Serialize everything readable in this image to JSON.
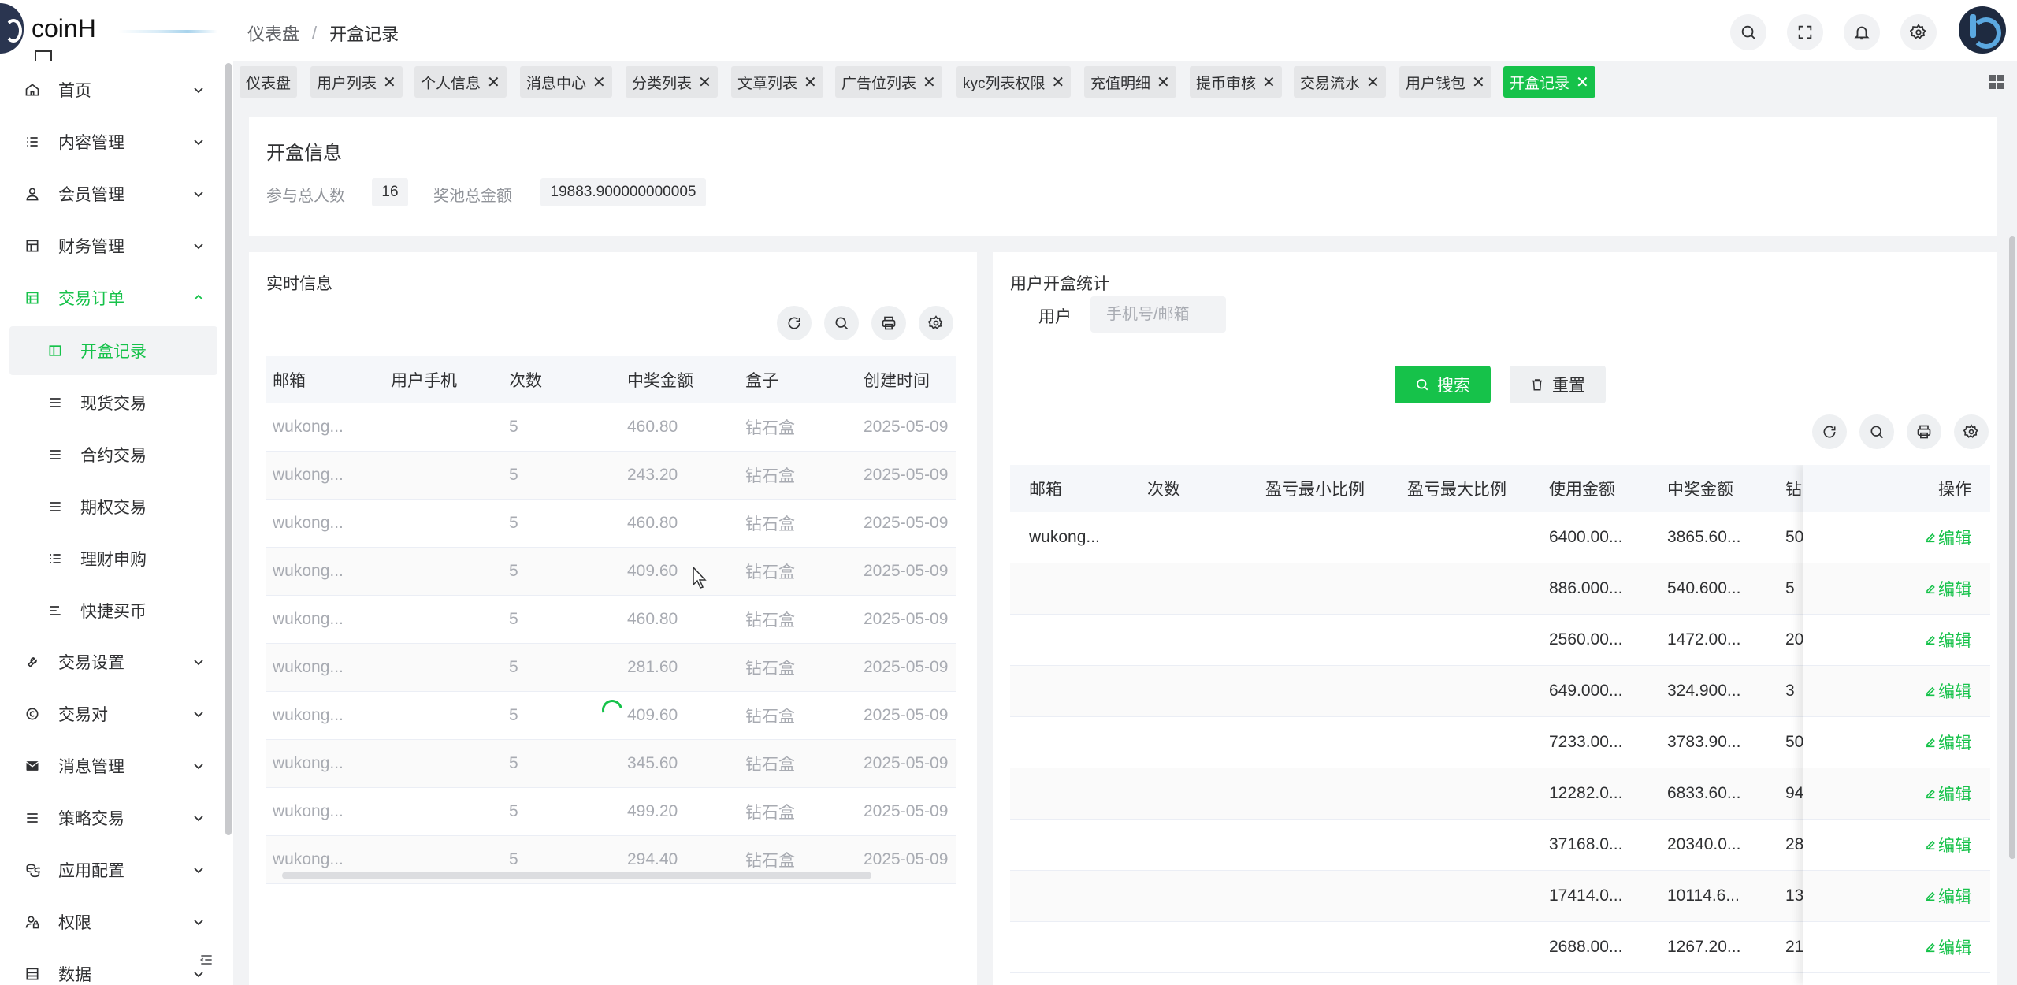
{
  "app": {
    "logo_text": "coinH"
  },
  "breadcrumb": {
    "parent": "仪表盘",
    "separator": "/",
    "current": "开盒记录"
  },
  "header_icons": [
    "search-icon",
    "fullscreen-icon",
    "bell-icon",
    "gear-icon"
  ],
  "sidebar": {
    "items": [
      {
        "label": "首页",
        "icon": "home-icon"
      },
      {
        "label": "内容管理",
        "icon": "list-icon"
      },
      {
        "label": "会员管理",
        "icon": "user-icon"
      },
      {
        "label": "财务管理",
        "icon": "layout-icon"
      },
      {
        "label": "交易订单",
        "icon": "table-icon",
        "expanded": true
      },
      {
        "label": "交易设置",
        "icon": "tool-icon"
      },
      {
        "label": "交易对",
        "icon": "copyright-icon"
      },
      {
        "label": "消息管理",
        "icon": "mail-icon"
      },
      {
        "label": "策略交易",
        "icon": "menu-icon"
      },
      {
        "label": "应用配置",
        "icon": "coins-icon"
      },
      {
        "label": "权限",
        "icon": "user-lock-icon"
      },
      {
        "label": "数据",
        "icon": "data-icon"
      }
    ],
    "sub_items": [
      {
        "label": "开盒记录",
        "active": true
      },
      {
        "label": "现货交易"
      },
      {
        "label": "合约交易"
      },
      {
        "label": "期权交易"
      },
      {
        "label": "理财申购"
      },
      {
        "label": "快捷买币"
      }
    ]
  },
  "tabs": [
    {
      "label": "仪表盘",
      "closable": false
    },
    {
      "label": "用户列表"
    },
    {
      "label": "个人信息"
    },
    {
      "label": "消息中心"
    },
    {
      "label": "分类列表"
    },
    {
      "label": "文章列表"
    },
    {
      "label": "广告位列表"
    },
    {
      "label": "kyc列表权限"
    },
    {
      "label": "充值明细"
    },
    {
      "label": "提币审核"
    },
    {
      "label": "交易流水"
    },
    {
      "label": "用户钱包"
    },
    {
      "label": "开盒记录",
      "active": true
    }
  ],
  "tab_close_glyph": "✕",
  "summary": {
    "title": "开盒信息",
    "participants_label": "参与总人数",
    "participants_value": "16",
    "pool_label": "奖池总金额",
    "pool_value": "19883.900000000005"
  },
  "realtime": {
    "title": "实时信息",
    "columns": [
      "邮箱",
      "用户手机",
      "次数",
      "中奖金额",
      "盒子",
      "创建时间"
    ],
    "rows": [
      [
        "wukong...",
        "",
        "5",
        "460.80",
        "钻石盒",
        "2025-05-09"
      ],
      [
        "wukong...",
        "",
        "5",
        "243.20",
        "钻石盒",
        "2025-05-09"
      ],
      [
        "wukong...",
        "",
        "5",
        "460.80",
        "钻石盒",
        "2025-05-09"
      ],
      [
        "wukong...",
        "",
        "5",
        "409.60",
        "钻石盒",
        "2025-05-09"
      ],
      [
        "wukong...",
        "",
        "5",
        "460.80",
        "钻石盒",
        "2025-05-09"
      ],
      [
        "wukong...",
        "",
        "5",
        "281.60",
        "钻石盒",
        "2025-05-09"
      ],
      [
        "wukong...",
        "",
        "5",
        "409.60",
        "钻石盒",
        "2025-05-09"
      ],
      [
        "wukong...",
        "",
        "5",
        "345.60",
        "钻石盒",
        "2025-05-09"
      ],
      [
        "wukong...",
        "",
        "5",
        "499.20",
        "钻石盒",
        "2025-05-09"
      ],
      [
        "wukong...",
        "",
        "5",
        "294.40",
        "钻石盒",
        "2025-05-09"
      ]
    ]
  },
  "user_stats": {
    "title": "用户开盒统计",
    "user_label": "用户",
    "search_placeholder": "手机号/邮箱",
    "search_button": "搜索",
    "reset_button": "重置",
    "columns": [
      "邮箱",
      "次数",
      "盈亏最小比例",
      "盈亏最大比例",
      "使用金额",
      "中奖金额",
      "钻"
    ],
    "action_header": "操作",
    "action_label": "编辑",
    "rows": [
      [
        "wukong...",
        "",
        "",
        "",
        "6400.00...",
        "3865.60...",
        "50"
      ],
      [
        "",
        "",
        "",
        "",
        "886.000...",
        "540.600...",
        "5"
      ],
      [
        "",
        "",
        "",
        "",
        "2560.00...",
        "1472.00...",
        "20"
      ],
      [
        "",
        "",
        "",
        "",
        "649.000...",
        "324.900...",
        "3"
      ],
      [
        "",
        "",
        "",
        "",
        "7233.00...",
        "3783.90...",
        "50"
      ],
      [
        "",
        "",
        "",
        "",
        "12282.0...",
        "6833.60...",
        "94"
      ],
      [
        "",
        "",
        "",
        "",
        "37168.0...",
        "20340.0...",
        "28"
      ],
      [
        "",
        "",
        "",
        "",
        "17414.0...",
        "10114.6...",
        "13"
      ],
      [
        "",
        "",
        "",
        "",
        "2688.00...",
        "1267.20...",
        "21"
      ]
    ]
  },
  "colors": {
    "accent": "#16c24a",
    "tab_bg": "#e5e6e8",
    "page_bg": "#f2f3f5"
  }
}
